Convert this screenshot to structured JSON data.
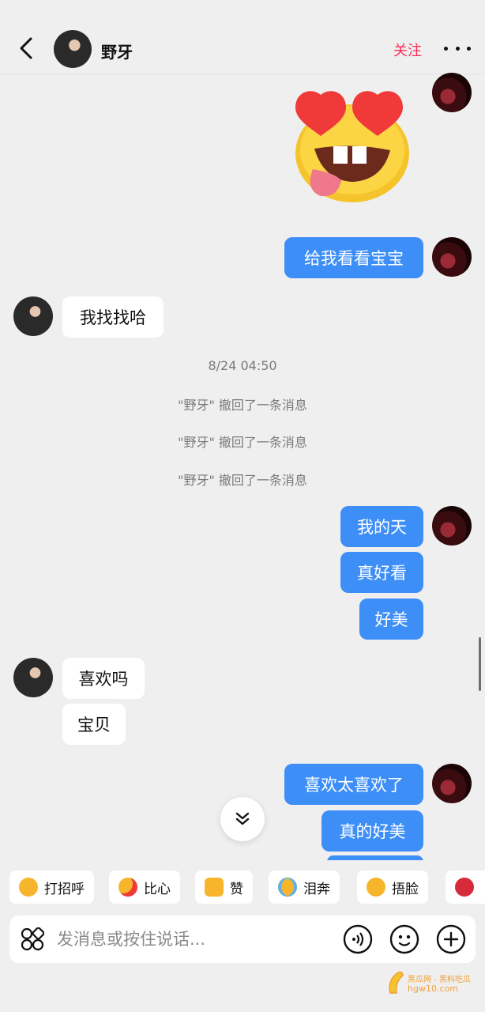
{
  "header": {
    "contact_name": "野牙",
    "follow_label": "关注"
  },
  "messages": {
    "out_1": "给我看看宝宝",
    "in_1": "我找找哈",
    "timestamp": "8/24 04:50",
    "recall_1": "\"野牙\" 撤回了一条消息",
    "recall_2": "\"野牙\" 撤回了一条消息",
    "recall_3": "\"野牙\" 撤回了一条消息",
    "out_2": "我的天",
    "out_3": "真好看",
    "out_4": "好美",
    "in_2": "喜欢吗",
    "in_3": "宝贝",
    "out_5": "喜欢太喜欢了",
    "out_6": "真的好美"
  },
  "quick_replies": [
    "打招呼",
    "比心",
    "赞",
    "泪奔",
    "捂脸"
  ],
  "input": {
    "placeholder": "发消息或按住说话..."
  },
  "watermark": {
    "line1": "黑瓜网 - 黑料吃瓜",
    "line2": "hgw10.com"
  },
  "colors": {
    "accent": "#fe2c55",
    "outgoing_bubble": "#3e8ef7",
    "incoming_bubble": "#ffffff",
    "background": "#efefef"
  }
}
